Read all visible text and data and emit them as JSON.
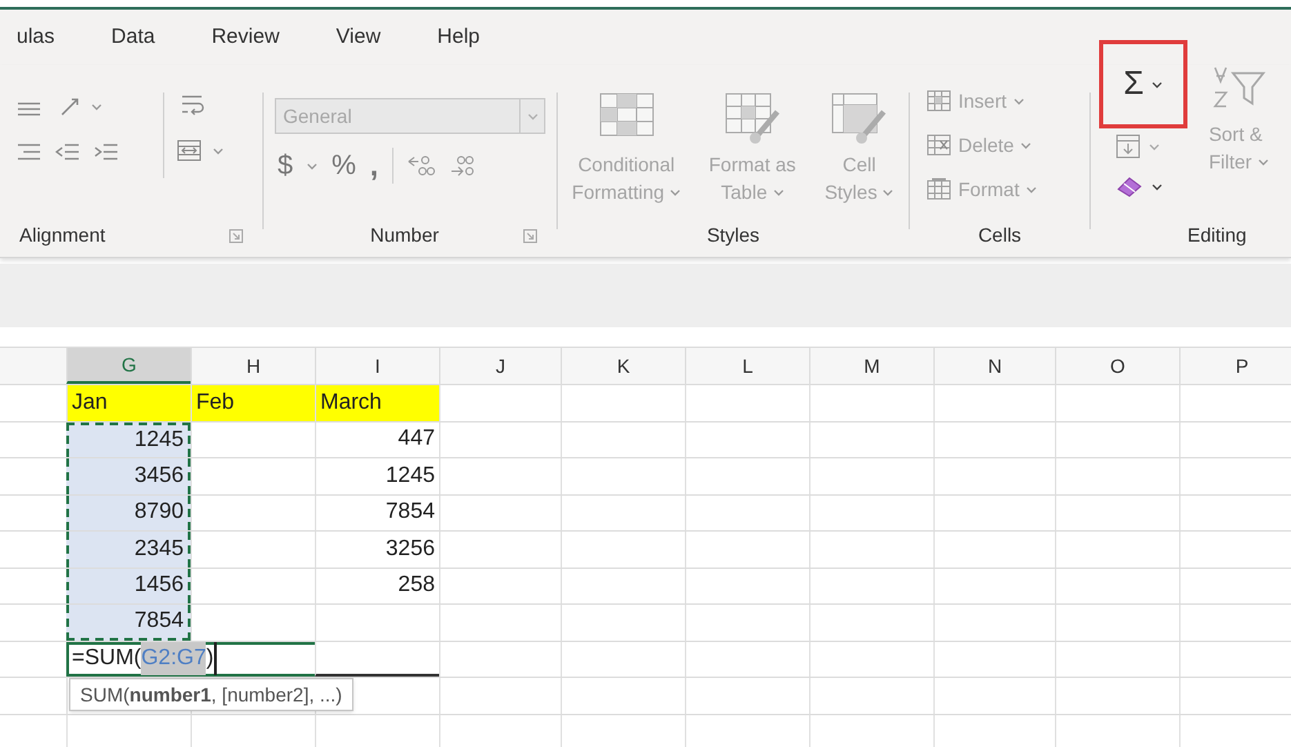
{
  "menu_tabs": [
    {
      "label": "ulas"
    },
    {
      "label": "Data"
    },
    {
      "label": "Review"
    },
    {
      "label": "View"
    },
    {
      "label": "Help"
    }
  ],
  "ribbon": {
    "alignment": {
      "label": "Alignment"
    },
    "number": {
      "label": "Number",
      "format": "General",
      "format_disabled": true,
      "currency": "$",
      "percent": "%",
      "comma": ","
    },
    "styles": {
      "label": "Styles",
      "buttons": [
        {
          "label": "Conditional Formatting",
          "disabled": true
        },
        {
          "label": "Format as Table",
          "disabled": true
        },
        {
          "label": "Cell Styles",
          "disabled": true
        }
      ]
    },
    "cells": {
      "label": "Cells",
      "buttons": [
        {
          "label": "Insert",
          "disabled": true
        },
        {
          "label": "Delete",
          "disabled": true
        },
        {
          "label": "Format",
          "disabled": true
        }
      ]
    },
    "editing": {
      "label": "Editing",
      "autosum": "Σ",
      "autosum_highlighted": true,
      "sort_filter": "Sort & Filter",
      "sort_disabled": true
    }
  },
  "sheet": {
    "columns": [
      {
        "label": "G",
        "selected": true
      },
      {
        "label": "H",
        "selected": false
      },
      {
        "label": "I",
        "selected": false
      },
      {
        "label": "J",
        "selected": false
      },
      {
        "label": "K",
        "selected": false
      },
      {
        "label": "L",
        "selected": false
      },
      {
        "label": "M",
        "selected": false
      },
      {
        "label": "N",
        "selected": false
      },
      {
        "label": "O",
        "selected": false
      },
      {
        "label": "P",
        "selected": false
      }
    ],
    "rows": [
      [
        {
          "text": "Jan",
          "highlighted": true,
          "in_range": false
        },
        {
          "text": "Feb",
          "highlighted": true,
          "in_range": false
        },
        {
          "text": "March",
          "highlighted": true,
          "in_range": false
        }
      ],
      [
        {
          "text": "1245",
          "highlighted": false,
          "in_range": true
        },
        {
          "text": "",
          "highlighted": false,
          "in_range": false
        },
        {
          "text": "447",
          "highlighted": false,
          "in_range": false
        }
      ],
      [
        {
          "text": "3456",
          "highlighted": false,
          "in_range": true
        },
        {
          "text": "",
          "highlighted": false,
          "in_range": false
        },
        {
          "text": "1245",
          "highlighted": false,
          "in_range": false
        }
      ],
      [
        {
          "text": "8790",
          "highlighted": false,
          "in_range": true
        },
        {
          "text": "",
          "highlighted": false,
          "in_range": false
        },
        {
          "text": "7854",
          "highlighted": false,
          "in_range": false
        }
      ],
      [
        {
          "text": "2345",
          "highlighted": false,
          "in_range": true
        },
        {
          "text": "",
          "highlighted": false,
          "in_range": false
        },
        {
          "text": "3256",
          "highlighted": false,
          "in_range": false
        }
      ],
      [
        {
          "text": "1456",
          "highlighted": false,
          "in_range": true
        },
        {
          "text": "",
          "highlighted": false,
          "in_range": false
        },
        {
          "text": "258",
          "highlighted": false,
          "in_range": false
        }
      ],
      [
        {
          "text": "7854",
          "highlighted": false,
          "in_range": true
        },
        {
          "text": "",
          "highlighted": false,
          "in_range": false
        },
        {
          "text": "",
          "highlighted": false,
          "in_range": false
        }
      ]
    ],
    "formula": {
      "prefix": "=SUM(",
      "reference": "G2:G7",
      "suffix": ")"
    },
    "tooltip": "SUM(**number1**, [number2], ...)"
  }
}
